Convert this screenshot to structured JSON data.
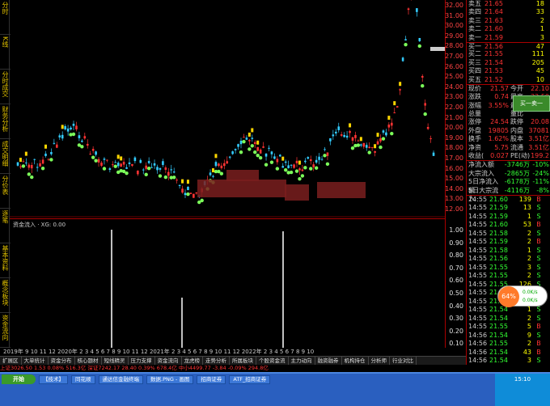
{
  "left_panel": [
    "分时",
    "K线",
    "分时成交",
    "财务分析",
    "成交明细",
    "分价表",
    "逐笔",
    "基本资料",
    "概念板块",
    "资金流向"
  ],
  "main_axis": [
    "32.00",
    "31.00",
    "30.00",
    "29.00",
    "28.00",
    "27.00",
    "26.00",
    "25.00",
    "24.00",
    "23.00",
    "22.00",
    "21.00",
    "20.00",
    "19.00",
    "18.00",
    "17.00",
    "16.00",
    "15.00",
    "14.00",
    "13.00",
    "12.00"
  ],
  "indicator_title": "资金流入 · XG: 0.00",
  "indicator_axis": [
    "1.00",
    "0.90",
    "0.80",
    "0.70",
    "0.60",
    "0.50",
    "0.40",
    "0.30",
    "0.20",
    "0.10"
  ],
  "orderbook": [
    {
      "label": "卖五",
      "price": "21.65",
      "vol": "18"
    },
    {
      "label": "卖四",
      "price": "21.64",
      "vol": "33"
    },
    {
      "label": "卖三",
      "price": "21.63",
      "vol": "2"
    },
    {
      "label": "卖二",
      "price": "21.60",
      "vol": "1"
    },
    {
      "label": "卖一",
      "price": "21.59",
      "vol": "3"
    },
    {
      "label": "买一",
      "price": "21.56",
      "vol": "47"
    },
    {
      "label": "买二",
      "price": "21.55",
      "vol": "111"
    },
    {
      "label": "买三",
      "price": "21.54",
      "vol": "205"
    },
    {
      "label": "买四",
      "price": "21.53",
      "vol": "45"
    },
    {
      "label": "买五",
      "price": "21.52",
      "vol": "10"
    }
  ],
  "stats": [
    {
      "a": "现价",
      "b": "21.57",
      "c": "今开",
      "d": "22.10"
    },
    {
      "a": "涨跌",
      "b": "0.74",
      "c": "最高",
      "d": "22.50"
    },
    {
      "a": "涨幅",
      "b": "3.55%",
      "c": "最低",
      "d": "21.30"
    },
    {
      "a": "总量",
      "b": "",
      "c": "量比",
      "d": ""
    },
    {
      "a": "涨停",
      "b": "24.54",
      "c": "跌停",
      "d": "20.08"
    },
    {
      "a": "外盘",
      "b": "19805",
      "c": "内盘",
      "d": "37081"
    },
    {
      "a": "换手",
      "b": "1.62%",
      "c": "股本",
      "d": "3.51亿"
    },
    {
      "a": "净资",
      "b": "5.75",
      "c": "流通",
      "d": "3.51亿"
    },
    {
      "a": "收益(",
      "b": "0.027",
      "c": "PE(动)",
      "d": "199.2"
    }
  ],
  "flows": [
    {
      "a": "净流入额",
      "b": "-3746万",
      "c": "-10%"
    },
    {
      "a": "大宗流入",
      "b": "-2865万",
      "c": "-24%"
    },
    {
      "a": "5日净流入额",
      "b": "-6178万",
      "c": "-11%"
    },
    {
      "a": "5日大宗流入",
      "b": "-4116万",
      "c": "-8%"
    }
  ],
  "ticks": [
    {
      "t": "14:55",
      "p": "21.60",
      "r": false,
      "v": "139",
      "s": "B"
    },
    {
      "t": "14:55",
      "p": "21.59",
      "r": false,
      "v": "13",
      "s": "S"
    },
    {
      "t": "14:55",
      "p": "21.59",
      "r": false,
      "v": "1",
      "s": "S"
    },
    {
      "t": "14:55",
      "p": "21.60",
      "r": false,
      "v": "53",
      "s": "B"
    },
    {
      "t": "14:55",
      "p": "21.58",
      "r": false,
      "v": "2",
      "s": "S"
    },
    {
      "t": "14:55",
      "p": "21.59",
      "r": false,
      "v": "2",
      "s": "B"
    },
    {
      "t": "14:55",
      "p": "21.58",
      "r": false,
      "v": "1",
      "s": "S"
    },
    {
      "t": "14:55",
      "p": "21.56",
      "r": false,
      "v": "2",
      "s": "S"
    },
    {
      "t": "14:55",
      "p": "21.55",
      "r": false,
      "v": "3",
      "s": "S"
    },
    {
      "t": "14:55",
      "p": "21.55",
      "r": false,
      "v": "2",
      "s": "S"
    },
    {
      "t": "14:55",
      "p": "21.55",
      "r": false,
      "v": "126",
      "s": "S"
    },
    {
      "t": "14:55",
      "p": "21.55",
      "r": false,
      "v": "15",
      "s": "S"
    },
    {
      "t": "14:55",
      "p": "21.55",
      "r": false,
      "v": "10",
      "s": "S"
    },
    {
      "t": "14:55",
      "p": "21.54",
      "r": false,
      "v": "1",
      "s": "S"
    },
    {
      "t": "14:55",
      "p": "21.54",
      "r": false,
      "v": "2",
      "s": "S"
    },
    {
      "t": "14:55",
      "p": "21.55",
      "r": false,
      "v": "5",
      "s": "B"
    },
    {
      "t": "14:56",
      "p": "21.54",
      "r": false,
      "v": "9",
      "s": "S"
    },
    {
      "t": "14:56",
      "p": "21.55",
      "r": false,
      "v": "2",
      "s": "B"
    },
    {
      "t": "14:56",
      "p": "21.54",
      "r": false,
      "v": "43",
      "s": "B"
    },
    {
      "t": "14:56",
      "p": "21.54",
      "r": false,
      "v": "3",
      "s": "S"
    },
    {
      "t": "14:56",
      "p": "21.54",
      "r": false,
      "v": "38",
      "s": "S"
    },
    {
      "t": "14:56",
      "p": "21.54",
      "r": false,
      "v": "1",
      "s": "S"
    },
    {
      "t": "14:56",
      "p": "21.57",
      "r": true,
      "v": "8",
      "s": "B"
    }
  ],
  "side_tabs": [
    "日线",
    "笔",
    "分时"
  ],
  "date_axis": "2019年 9 10 11 12 2020年 2 3 4 5 6 7 8 9 10 11 12 2021年 2 3 4 5 6 7 8 9 10 11 12 2022年 2 3 4 5 6 7 8 9 10",
  "bottom_tabs": [
    "扩展区",
    "大单统计",
    "资金分布",
    "核心题材",
    "短线精灵",
    "压力支撑",
    "资金流向",
    "龙虎榜",
    "走势分析",
    "所属板块",
    "个股资金流",
    "主力动向",
    "融资融券",
    "机构持仓",
    "分析师",
    "行业对比"
  ],
  "ticker": "上证3026.50  1.53  0.08%  516.3亿 深证7242.17  28.40  0.39%  678.4亿 中小4499.77  -3.84  -0.09%  294.8亿",
  "taskbar": {
    "start": "开始",
    "buttons": [
      "【技术】",
      "同花顺",
      "通达信金融终端",
      "数据.PNG - 画图",
      "招商证券",
      "ATF_招商证券"
    ],
    "clock": "15:10"
  },
  "ad_card": "买一卖一",
  "bubble": {
    "pct": "64%",
    "up": "0.0K/s",
    "down": "0.0K/s"
  }
}
